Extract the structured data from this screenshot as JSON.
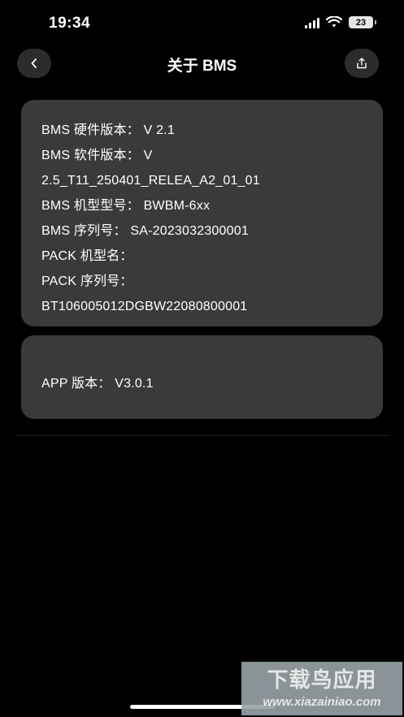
{
  "status_bar": {
    "time": "19:34",
    "battery": "23"
  },
  "nav": {
    "title": "关于 BMS"
  },
  "bms_info": [
    "BMS 硬件版本： V 2.1",
    "BMS 软件版本： V",
    "2.5_T11_250401_RELEA_A2_01_01",
    "BMS 机型型号： BWBM-6xx",
    "BMS 序列号： SA-2023032300001",
    "PACK 机型名：",
    "PACK 序列号：",
    "BT106005012DGBW22080800001"
  ],
  "app_info": {
    "version": "APP 版本： V3.0.1"
  },
  "watermark": {
    "brand": "下载鸟应用",
    "url": "www.xiazainiao.com"
  },
  "colors": {
    "background": "#000000",
    "card": "#3a3a3a",
    "button": "#2c2c2e"
  },
  "icons": {
    "back": "chevron-left-icon",
    "share": "share-icon",
    "signal": "cellular-signal-icon",
    "wifi": "wifi-icon",
    "battery": "battery-icon"
  }
}
